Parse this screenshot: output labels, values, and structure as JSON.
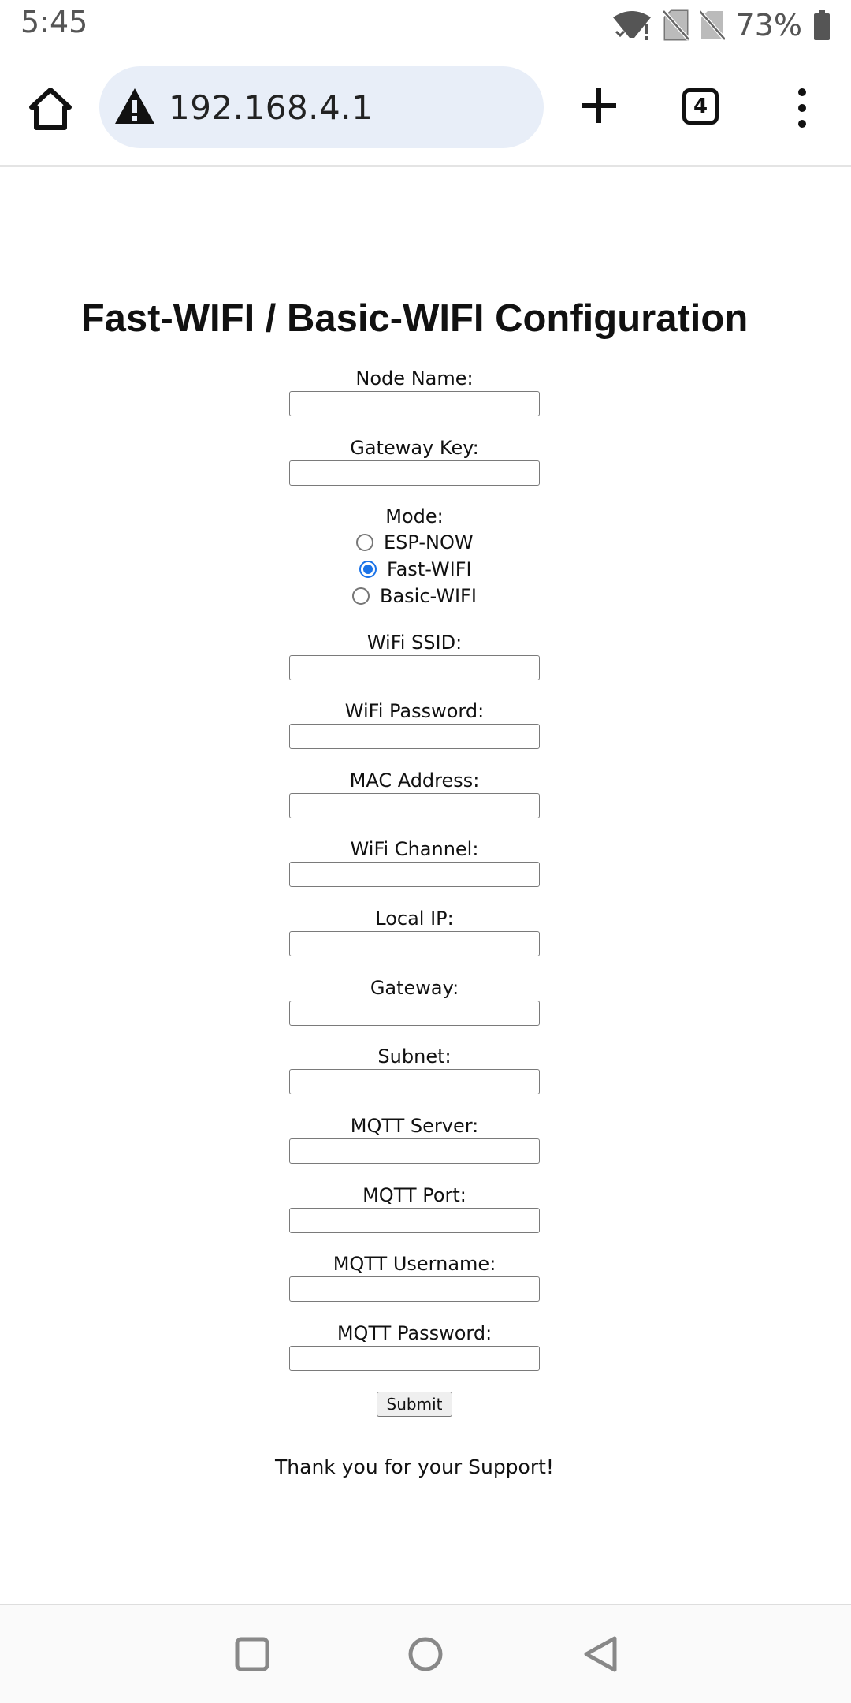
{
  "status_bar": {
    "time": "5:45",
    "battery": "73%",
    "icons": [
      "wifi-alert-icon",
      "no-sim-icon",
      "no-sim-icon",
      "battery-icon"
    ]
  },
  "browser": {
    "url": "192.168.4.1",
    "tab_count": "4",
    "icons": [
      "home-icon",
      "not-secure-warning-icon",
      "new-tab-plus-icon",
      "tab-switcher-icon",
      "more-menu-icon"
    ]
  },
  "page": {
    "title": "Fast-WIFI / Basic-WIFI Configuration",
    "fields_top": [
      {
        "label": "Node Name:",
        "value": ""
      },
      {
        "label": "Gateway Key:",
        "value": ""
      }
    ],
    "mode": {
      "label": "Mode:",
      "options": [
        {
          "label": "ESP-NOW",
          "selected": false
        },
        {
          "label": "Fast-WIFI",
          "selected": true
        },
        {
          "label": "Basic-WIFI",
          "selected": false
        }
      ]
    },
    "fields": [
      {
        "label": "WiFi SSID:",
        "value": ""
      },
      {
        "label": "WiFi Password:",
        "value": ""
      },
      {
        "label": "MAC Address:",
        "value": ""
      },
      {
        "label": "WiFi Channel:",
        "value": ""
      },
      {
        "label": "Local IP:",
        "value": ""
      },
      {
        "label": "Gateway:",
        "value": ""
      },
      {
        "label": "Subnet:",
        "value": ""
      },
      {
        "label": "MQTT Server:",
        "value": ""
      },
      {
        "label": "MQTT Port:",
        "value": ""
      },
      {
        "label": "MQTT Username:",
        "value": ""
      },
      {
        "label": "MQTT Password:",
        "value": ""
      }
    ],
    "submit_label": "Submit",
    "footer_text": "Thank you for your Support!"
  },
  "nav": {
    "icons": [
      "recents-square-icon",
      "home-circle-icon",
      "back-triangle-icon"
    ]
  },
  "colors": {
    "accent": "#1a73e8",
    "url_bar_bg": "#e8eef8"
  }
}
